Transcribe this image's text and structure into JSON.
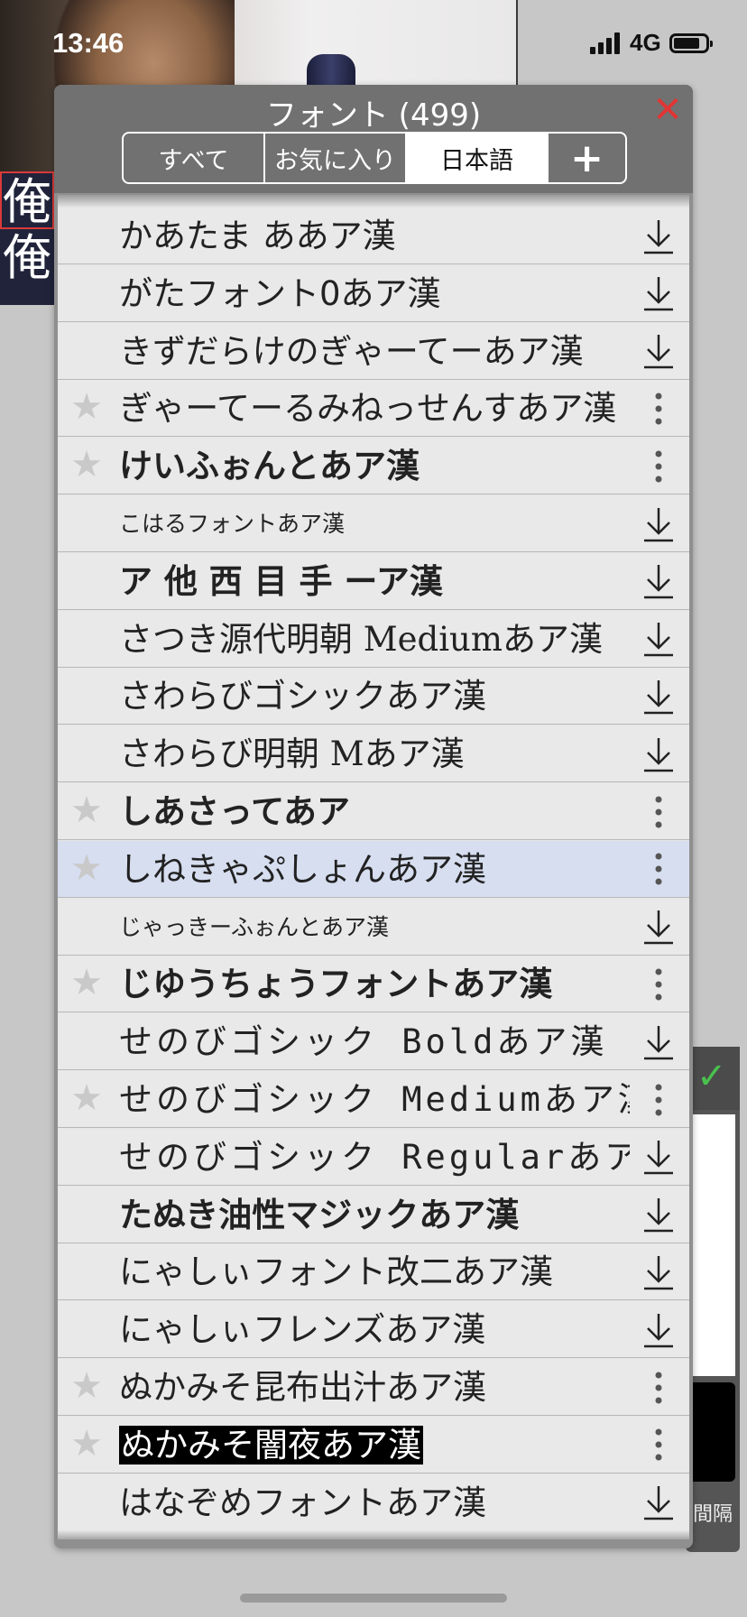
{
  "status_bar": {
    "time": "13:46",
    "network": "4G"
  },
  "background": {
    "left_text": [
      "俺",
      "俺"
    ],
    "panel_label": "間隔"
  },
  "dialog": {
    "title": "フォント (499)",
    "close_icon": "close-icon",
    "tabs": [
      "すべて",
      "お気に入り",
      "日本語",
      "+"
    ],
    "selected_tab": "日本語"
  },
  "fonts": [
    {
      "name": "かあたま ああア漢",
      "action": "download",
      "fav": false
    },
    {
      "name": "がたフォント0あア漢",
      "action": "download",
      "fav": false
    },
    {
      "name": "きずだらけのぎゃーてーあア漢",
      "action": "download",
      "fav": false
    },
    {
      "name": "ぎゃーてーるみねっせんすあア漢",
      "action": "more",
      "fav": true
    },
    {
      "name": "けいふぉんとあア漢",
      "action": "more",
      "fav": true
    },
    {
      "name": "こはるフォントあア漢",
      "action": "download",
      "fav": false
    },
    {
      "name": "ア 他 西 目 手 ーア漢",
      "action": "download",
      "fav": false
    },
    {
      "name": "さつき源代明朝 Mediumあア漢",
      "action": "download",
      "fav": false
    },
    {
      "name": "さわらびゴシックあア漢",
      "action": "download",
      "fav": false
    },
    {
      "name": "さわらび明朝 Mあア漢",
      "action": "download",
      "fav": false
    },
    {
      "name": "しあさってあア",
      "action": "more",
      "fav": true
    },
    {
      "name": "しねきゃぷしょんあア漢",
      "action": "more",
      "fav": true,
      "highlight": true
    },
    {
      "name": "じゃっきーふぉんとあア漢",
      "action": "download",
      "fav": false
    },
    {
      "name": "じゆうちょうフォントあア漢",
      "action": "more",
      "fav": true
    },
    {
      "name": "せのびゴシック Boldあア漢",
      "action": "download",
      "fav": false
    },
    {
      "name": "せのびゴシック Mediumあア漢",
      "action": "more",
      "fav": true
    },
    {
      "name": "せのびゴシック Regularあア漢",
      "action": "download",
      "fav": false
    },
    {
      "name": "たぬき油性マジックあア漢",
      "action": "download",
      "fav": false
    },
    {
      "name": "にゃしぃフォント改二あア漢",
      "action": "download",
      "fav": false
    },
    {
      "name": "にゃしぃフレンズあア漢",
      "action": "download",
      "fav": false
    },
    {
      "name": "ぬかみそ昆布出汁あア漢",
      "action": "more",
      "fav": true
    },
    {
      "name": "ぬかみそ闇夜あア漢",
      "action": "more",
      "fav": true
    },
    {
      "name": "はなぞめフォントあア漢",
      "action": "download",
      "fav": false
    }
  ],
  "colors": {
    "close": "#e23434",
    "highlight_row": "#d6def0",
    "check": "#49c14d"
  }
}
